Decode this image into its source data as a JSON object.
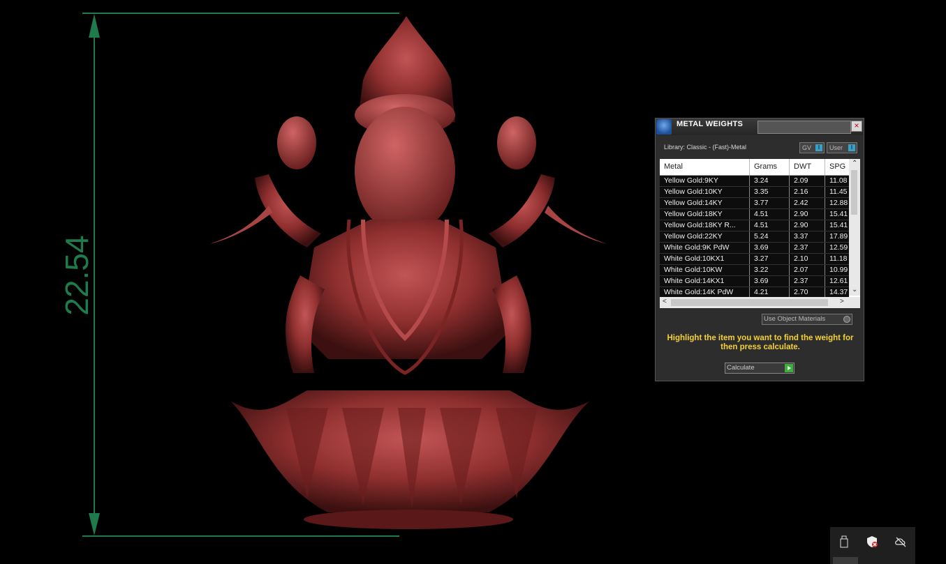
{
  "dimension": {
    "value": "22.54",
    "color": "#1f7a4c"
  },
  "model": {
    "color": "#8f2f2f"
  },
  "metal_weights": {
    "title": "METAL WEIGHTS",
    "close_icon": "×",
    "library": "Library: Classic - (Fast)-Metal",
    "toggle_gv": "GV",
    "toggle_user": "User",
    "toggle_knob": "I",
    "columns": [
      "Metal",
      "Grams",
      "DWT",
      "SPG"
    ],
    "rows": [
      [
        "Yellow Gold:9KY",
        "3.24",
        "2.09",
        "11.08"
      ],
      [
        "Yellow Gold:10KY",
        "3.35",
        "2.16",
        "11.45"
      ],
      [
        "Yellow Gold:14KY",
        "3.77",
        "2.42",
        "12.88"
      ],
      [
        "Yellow Gold:18KY",
        "4.51",
        "2.90",
        "15.41"
      ],
      [
        "Yellow Gold:18KY R...",
        "4.51",
        "2.90",
        "15.41"
      ],
      [
        "Yellow Gold:22KY",
        "5.24",
        "3.37",
        "17.89"
      ],
      [
        "White Gold:9K PdW",
        "3.69",
        "2.37",
        "12.59"
      ],
      [
        "White Gold:10KX1",
        "3.27",
        "2.10",
        "11.18"
      ],
      [
        "White Gold:10KW",
        "3.22",
        "2.07",
        "10.99"
      ],
      [
        "White Gold:14KX1",
        "3.69",
        "2.37",
        "12.61"
      ],
      [
        "White Gold:14K PdW",
        "4.21",
        "2.70",
        "14.37"
      ]
    ],
    "use_object_materials": "Use Object Materials",
    "hint": "Highlight the item you want to find the weight for then press calculate.",
    "calculate": "Calculate",
    "accent": "#f6d135"
  },
  "tray": {
    "icons": [
      "usb-drive-icon",
      "security-shield-icon",
      "cloud-offline-icon"
    ]
  }
}
